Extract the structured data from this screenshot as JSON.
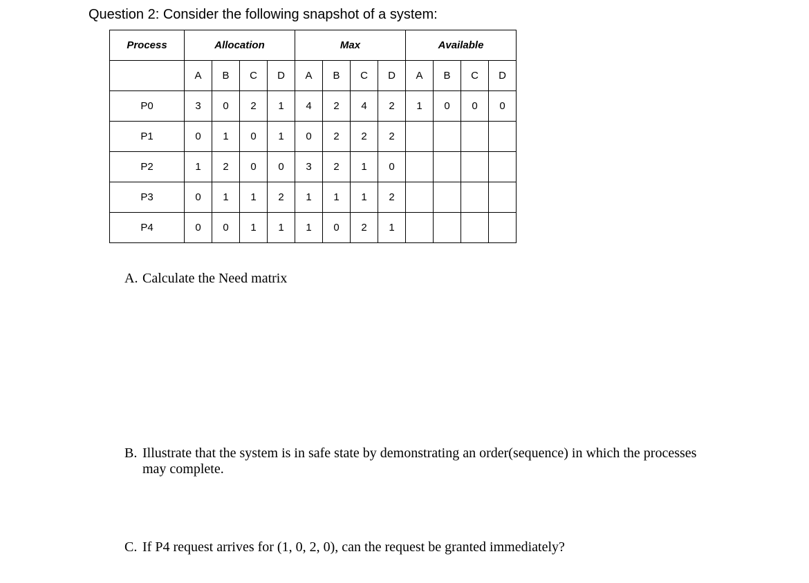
{
  "question_title": "Question 2: Consider the following snapshot of a system:",
  "headers": {
    "process": "Process",
    "allocation": "Allocation",
    "max": "Max",
    "available": "Available"
  },
  "sub_headers": [
    "A",
    "B",
    "C",
    "D"
  ],
  "rows": [
    {
      "process": "P0",
      "allocation": [
        "3",
        "0",
        "2",
        "1"
      ],
      "max": [
        "4",
        "2",
        "4",
        "2"
      ],
      "available": [
        "1",
        "0",
        "0",
        "0"
      ]
    },
    {
      "process": "P1",
      "allocation": [
        "0",
        "1",
        "0",
        "1"
      ],
      "max": [
        "0",
        "2",
        "2",
        "2"
      ],
      "available": [
        "",
        "",
        "",
        ""
      ]
    },
    {
      "process": "P2",
      "allocation": [
        "1",
        "2",
        "0",
        "0"
      ],
      "max": [
        "3",
        "2",
        "1",
        "0"
      ],
      "available": [
        "",
        "",
        "",
        ""
      ]
    },
    {
      "process": "P3",
      "allocation": [
        "0",
        "1",
        "1",
        "2"
      ],
      "max": [
        "1",
        "1",
        "1",
        "2"
      ],
      "available": [
        "",
        "",
        "",
        ""
      ]
    },
    {
      "process": "P4",
      "allocation": [
        "0",
        "0",
        "1",
        "1"
      ],
      "max": [
        "1",
        "0",
        "2",
        "1"
      ],
      "available": [
        "",
        "",
        "",
        ""
      ]
    }
  ],
  "parts": {
    "a_letter": "A.",
    "a_text": "Calculate the Need matrix",
    "b_letter": "B.",
    "b_text": "Illustrate that the system is in safe state by demonstrating an order(sequence) in which the processes may complete.",
    "c_letter": "C.",
    "c_text": "If P4 request arrives for (1, 0, 2, 0), can the request be granted immediately?"
  }
}
